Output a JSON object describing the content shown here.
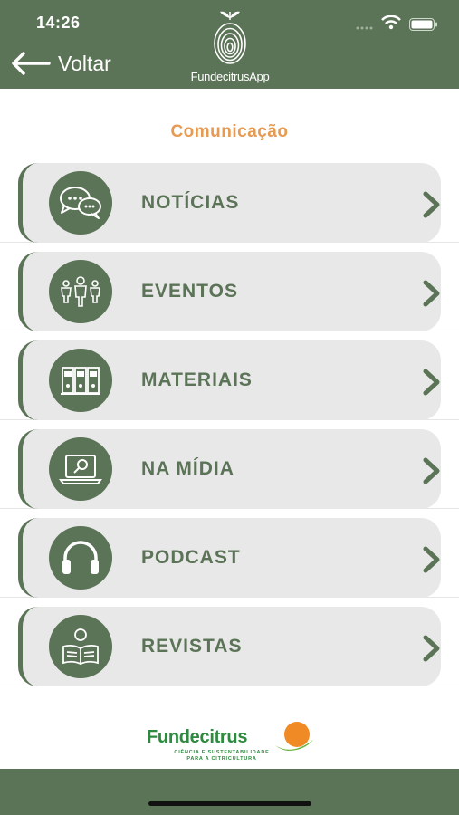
{
  "status_bar": {
    "time": "14:26"
  },
  "header": {
    "back_label": "Voltar",
    "app_name": "FundecitrusApp"
  },
  "section_title": "Comunicação",
  "menu_items": [
    {
      "label": "NOTÍCIAS",
      "icon": "chat-bubbles-icon"
    },
    {
      "label": "EVENTOS",
      "icon": "people-group-icon"
    },
    {
      "label": "MATERIAIS",
      "icon": "binders-icon"
    },
    {
      "label": "NA MÍDIA",
      "icon": "laptop-search-icon"
    },
    {
      "label": "PODCAST",
      "icon": "headphones-icon"
    },
    {
      "label": "REVISTAS",
      "icon": "reader-icon"
    }
  ],
  "brand": {
    "name": "Fundecitrus",
    "tagline_line1": "CIÊNCIA E SUSTENTABILIDADE",
    "tagline_line2": "PARA A CITRICULTURA"
  },
  "colors": {
    "primary": "#5b7356",
    "accent": "#e69a52",
    "card": "#e8e8e8",
    "brand_green": "#2d8a3e",
    "brand_orange": "#f08a24"
  }
}
